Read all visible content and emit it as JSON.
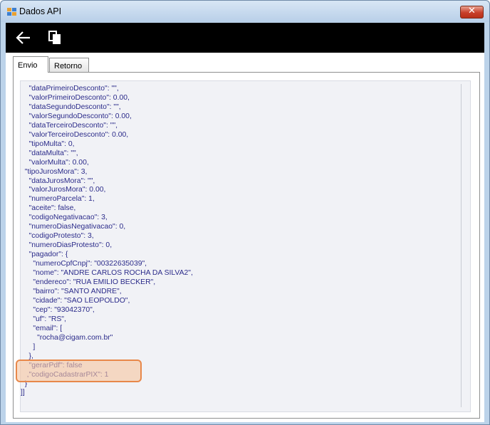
{
  "window": {
    "title": "Dados API",
    "close_label": "✕"
  },
  "toolbar": {
    "back_icon": "arrow-left-icon",
    "copy_icon": "copy-icon"
  },
  "tabs": [
    {
      "label": "Envio",
      "active": true
    },
    {
      "label": "Retorno",
      "active": false
    }
  ],
  "content": {
    "lines": [
      "    \"dataPrimeiroDesconto\": \"\",",
      "    \"valorPrimeiroDesconto\": 0.00,",
      "    \"dataSegundoDesconto\": \"\",",
      "    \"valorSegundoDesconto\": 0.00,",
      "    \"dataTerceiroDesconto\": \"\",",
      "    \"valorTerceiroDesconto\": 0.00,",
      "    \"tipoMulta\": 0,",
      "    \"dataMulta\": \"\",",
      "    \"valorMulta\": 0.00,",
      "  \"tipoJurosMora\": 3,",
      "    \"dataJurosMora\": \"\",",
      "    \"valorJurosMora\": 0.00,",
      "    \"numeroParcela\": 1,",
      "    \"aceite\": false,",
      "    \"codigoNegativacao\": 3,",
      "    \"numeroDiasNegativacao\": 0,",
      "    \"codigoProtesto\": 3,",
      "    \"numeroDiasProtesto\": 0,",
      "    \"pagador\": {",
      "      \"numeroCpfCnpj\": \"00322635039\",",
      "      \"nome\": \"ANDRE CARLOS ROCHA DA SILVA2\",",
      "      \"endereco\": \"RUA EMILIO BECKER\",",
      "      \"bairro\": \"SANTO ANDRE\",",
      "      \"cidade\": \"SAO LEOPOLDO\",",
      "      \"cep\": \"93042370\",",
      "      \"uf\": \"RS\",",
      "      \"email\": [",
      "        \"rocha@cigam.com.br\"",
      "      ]",
      "    },",
      "    \"gerarPdf\": false",
      "   ,\"codigoCadastrarPIX\": 1",
      "  }",
      "]]"
    ]
  },
  "colors": {
    "text": "#2b2b8a",
    "toolbar": "#000000",
    "highlight_border": "#e8884a",
    "highlight_fill": "#f7c4a0"
  }
}
